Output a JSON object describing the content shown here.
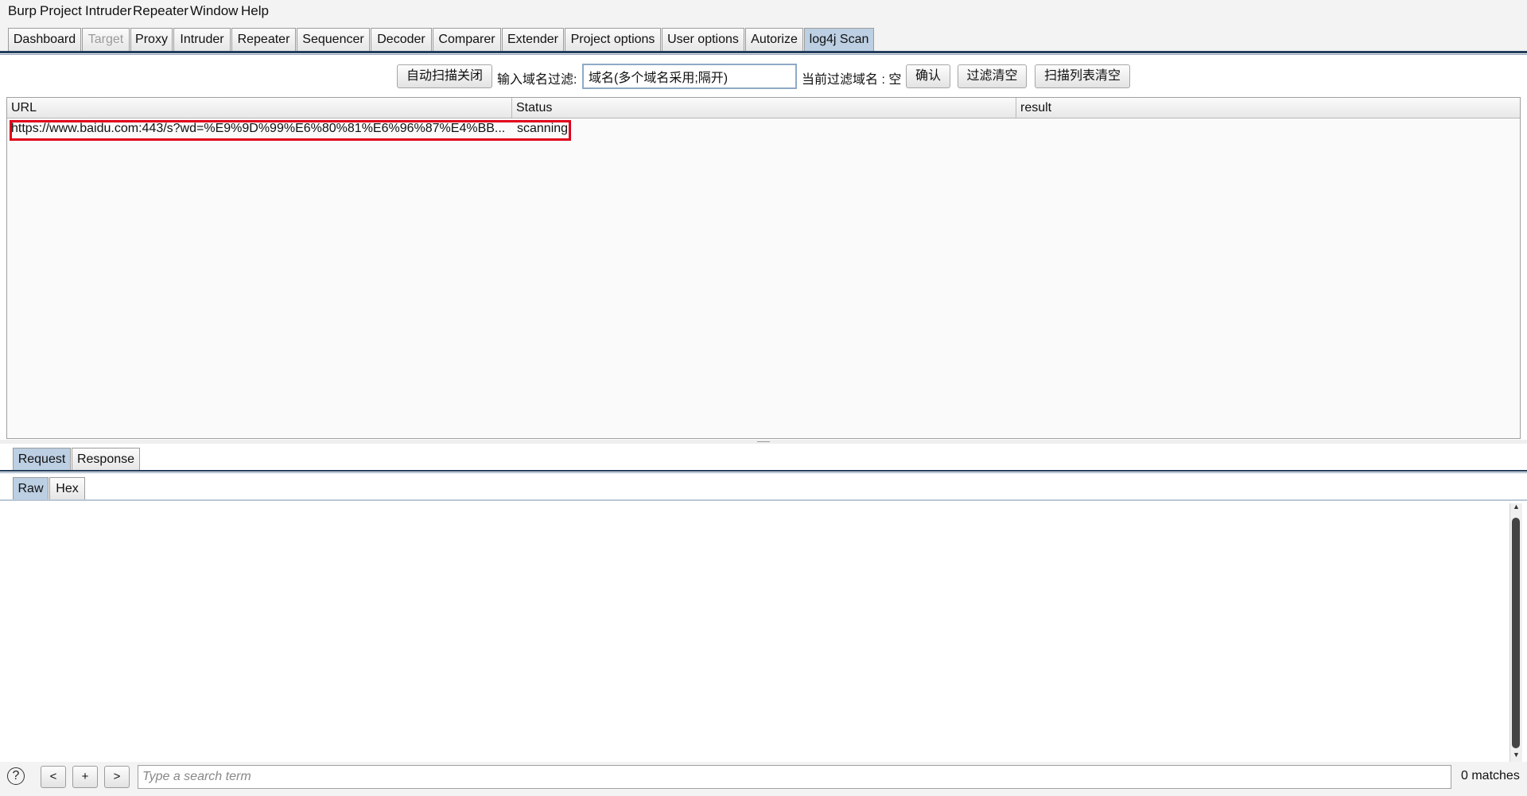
{
  "menu": [
    "Burp",
    "Project",
    "Intruder",
    "Repeater",
    "Window",
    "Help"
  ],
  "tabs": [
    {
      "label": "Dashboard",
      "state": "normal"
    },
    {
      "label": "Target",
      "state": "disabled"
    },
    {
      "label": "Proxy",
      "state": "normal"
    },
    {
      "label": "Intruder",
      "state": "normal"
    },
    {
      "label": "Repeater",
      "state": "normal"
    },
    {
      "label": "Sequencer",
      "state": "normal"
    },
    {
      "label": "Decoder",
      "state": "normal"
    },
    {
      "label": "Comparer",
      "state": "normal"
    },
    {
      "label": "Extender",
      "state": "normal"
    },
    {
      "label": "Project options",
      "state": "normal"
    },
    {
      "label": "User options",
      "state": "normal"
    },
    {
      "label": "Autorize",
      "state": "normal"
    },
    {
      "label": "log4j Scan",
      "state": "active"
    }
  ],
  "toolbar": {
    "auto_scan_button": "自动扫描关闭",
    "filter_label": "输入域名过滤:",
    "filter_value": "域名(多个域名采用;隔开)",
    "current_filter_label": "当前过滤域名 : 空",
    "confirm_button": "确认",
    "clear_filter_button": "过滤清空",
    "clear_list_button": "扫描列表清空"
  },
  "table": {
    "columns": [
      "URL",
      "Status",
      "result"
    ],
    "rows": [
      {
        "url": "https://www.baidu.com:443/s?wd=%E9%9D%99%E6%80%81%E6%96%87%E4%BB...",
        "status": "scanning",
        "result": ""
      }
    ]
  },
  "message_tabs": [
    "Request",
    "Response"
  ],
  "view_tabs": [
    "Raw",
    "Hex"
  ],
  "bottom": {
    "help": "?",
    "prev": "<",
    "add": "+",
    "next": ">",
    "search_placeholder": "Type a search term",
    "matches": "0 matches"
  },
  "colors": {
    "active_tab": "#bccfe3",
    "highlight": "#e0001b",
    "tab_rule": "#243e5c"
  }
}
